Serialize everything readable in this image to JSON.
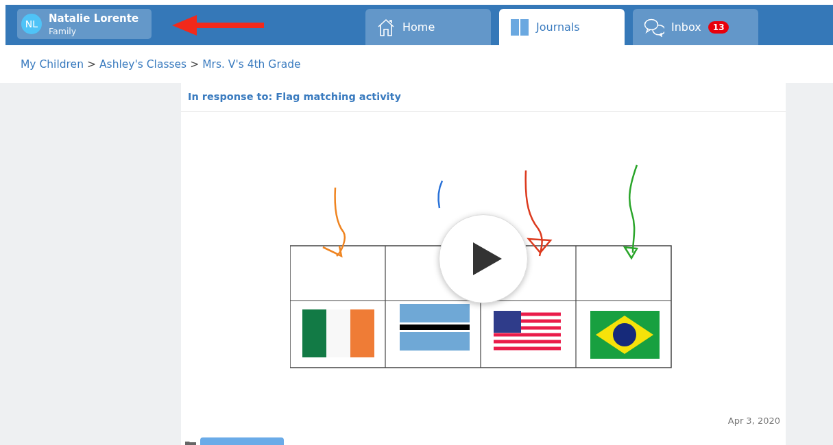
{
  "user": {
    "initials": "NL",
    "name": "Natalie Lorente",
    "role": "Family"
  },
  "tabs": [
    {
      "kind": "home",
      "label": "Home",
      "selected": false
    },
    {
      "kind": "journals",
      "label": "Journals",
      "selected": true
    },
    {
      "kind": "inbox",
      "label": "Inbox",
      "selected": false,
      "badge": "13"
    }
  ],
  "breadcrumb": [
    {
      "label": "My Children"
    },
    {
      "separator": ">",
      "label": "Ashley's Classes"
    },
    {
      "separator": ">",
      "label": "Mrs. V's 4th Grade"
    }
  ],
  "post": {
    "heading": "In response to: Flag matching activity",
    "date": "Apr 3, 2020"
  }
}
